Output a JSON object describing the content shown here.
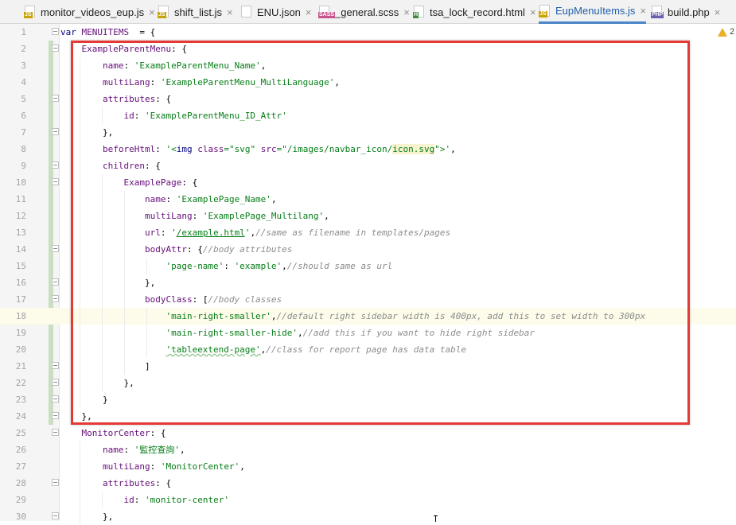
{
  "tabs": [
    {
      "name": "monitor_videos_eup.js",
      "type": "JS",
      "type_color": "#c8a400"
    },
    {
      "name": "shift_list.js",
      "type": "JS",
      "type_color": "#c8a400"
    },
    {
      "name": "ENU.json",
      "type": "",
      "type_color": "#9a9a9a"
    },
    {
      "name": "_general.scss",
      "type": "SASS",
      "type_color": "#c6538c"
    },
    {
      "name": "tsa_lock_record.html",
      "type": "H",
      "type_color": "#3e8e41"
    },
    {
      "name": "EupMenuItems.js",
      "type": "JS",
      "type_color": "#c8a400",
      "active": true
    },
    {
      "name": "build.php",
      "type": "PHP",
      "type_color": "#6b5fb0"
    }
  ],
  "close_glyph": "×",
  "warning_count": "2",
  "code_lines": [
    {
      "n": "1",
      "tokens": [
        [
          "k",
          "var "
        ],
        [
          "p",
          "MENUITEMS"
        ],
        [
          "",
          "  = {"
        ]
      ]
    },
    {
      "n": "2",
      "tokens": [
        [
          "",
          "    "
        ],
        [
          "p",
          "ExampleParentMenu"
        ],
        [
          "",
          ": {"
        ]
      ]
    },
    {
      "n": "3",
      "tokens": [
        [
          "",
          "        "
        ],
        [
          "p",
          "name"
        ],
        [
          "",
          ": "
        ],
        [
          "s",
          "'ExampleParentMenu_Name'"
        ],
        [
          "",
          ","
        ]
      ]
    },
    {
      "n": "4",
      "tokens": [
        [
          "",
          "        "
        ],
        [
          "p",
          "multiLang"
        ],
        [
          "",
          ": "
        ],
        [
          "s",
          "'ExampleParentMenu_MultiLanguage'"
        ],
        [
          "",
          ","
        ]
      ]
    },
    {
      "n": "5",
      "tokens": [
        [
          "",
          "        "
        ],
        [
          "p",
          "attributes"
        ],
        [
          "",
          ": {"
        ]
      ]
    },
    {
      "n": "6",
      "tokens": [
        [
          "",
          "            "
        ],
        [
          "p",
          "id"
        ],
        [
          "",
          ": "
        ],
        [
          "s",
          "'ExampleParentMenu_ID_Attr'"
        ]
      ]
    },
    {
      "n": "7",
      "tokens": [
        [
          "",
          "        },"
        ]
      ]
    },
    {
      "n": "8",
      "tokens": [
        [
          "",
          "        "
        ],
        [
          "p",
          "beforeHtml"
        ],
        [
          "",
          ": "
        ],
        [
          "s",
          "'<"
        ],
        [
          "k",
          "img "
        ],
        [
          "p",
          "class"
        ],
        [
          "s",
          "=\"svg\" "
        ],
        [
          "p",
          "src"
        ],
        [
          "s",
          "=\"/images/navbar_icon/"
        ],
        [
          "sh",
          "icon.svg"
        ],
        [
          "s",
          "\">'"
        ],
        [
          "",
          ","
        ]
      ]
    },
    {
      "n": "9",
      "tokens": [
        [
          "",
          "        "
        ],
        [
          "p",
          "children"
        ],
        [
          "",
          ": {"
        ]
      ]
    },
    {
      "n": "10",
      "tokens": [
        [
          "",
          "            "
        ],
        [
          "p",
          "ExamplePage"
        ],
        [
          "",
          ": {"
        ]
      ]
    },
    {
      "n": "11",
      "tokens": [
        [
          "",
          "                "
        ],
        [
          "p",
          "name"
        ],
        [
          "",
          ": "
        ],
        [
          "s",
          "'ExamplePage_Name'"
        ],
        [
          "",
          ","
        ]
      ]
    },
    {
      "n": "12",
      "tokens": [
        [
          "",
          "                "
        ],
        [
          "p",
          "multiLang"
        ],
        [
          "",
          ": "
        ],
        [
          "s",
          "'ExamplePage_Multilang'"
        ],
        [
          "",
          ","
        ]
      ]
    },
    {
      "n": "13",
      "tokens": [
        [
          "",
          "                "
        ],
        [
          "p",
          "url"
        ],
        [
          "",
          ": "
        ],
        [
          "s",
          "'"
        ],
        [
          "su",
          "/example.html"
        ],
        [
          "s",
          "'"
        ],
        [
          "",
          ","
        ],
        [
          "c",
          "//same as filename in templates/pages"
        ]
      ]
    },
    {
      "n": "14",
      "tokens": [
        [
          "",
          "                "
        ],
        [
          "p",
          "bodyAttr"
        ],
        [
          "",
          ": {"
        ],
        [
          "c",
          "//body attributes"
        ]
      ]
    },
    {
      "n": "15",
      "tokens": [
        [
          "",
          "                    "
        ],
        [
          "s",
          "'page-name'"
        ],
        [
          "",
          ": "
        ],
        [
          "s",
          "'example'"
        ],
        [
          "",
          ","
        ],
        [
          "c",
          "//should same as url"
        ]
      ]
    },
    {
      "n": "16",
      "tokens": [
        [
          "",
          "                },"
        ]
      ]
    },
    {
      "n": "17",
      "tokens": [
        [
          "",
          "                "
        ],
        [
          "p",
          "bodyClass"
        ],
        [
          "",
          ": ["
        ],
        [
          "c",
          "//body classes"
        ]
      ]
    },
    {
      "n": "18",
      "tokens": [
        [
          "",
          "                    "
        ],
        [
          "s",
          "'main-right-smaller'"
        ],
        [
          "",
          ","
        ],
        [
          "c",
          "//default right sidebar width is 400px, add this to set width to 300px"
        ]
      ],
      "current": true
    },
    {
      "n": "19",
      "tokens": [
        [
          "",
          "                    "
        ],
        [
          "s",
          "'main-right-smaller-hide'"
        ],
        [
          "",
          ","
        ],
        [
          "c",
          "//add this if you want to hide right sidebar"
        ]
      ]
    },
    {
      "n": "20",
      "tokens": [
        [
          "",
          "                    "
        ],
        [
          "sw",
          "'tableextend-page'"
        ],
        [
          "",
          ","
        ],
        [
          "c",
          "//class for report page has data table"
        ]
      ]
    },
    {
      "n": "21",
      "tokens": [
        [
          "",
          "                ]"
        ]
      ]
    },
    {
      "n": "22",
      "tokens": [
        [
          "",
          "            },"
        ]
      ]
    },
    {
      "n": "23",
      "tokens": [
        [
          "",
          "        }"
        ]
      ]
    },
    {
      "n": "24",
      "tokens": [
        [
          "",
          "    },"
        ]
      ]
    },
    {
      "n": "25",
      "tokens": [
        [
          "",
          "    "
        ],
        [
          "p",
          "MonitorCenter"
        ],
        [
          "",
          ": {"
        ]
      ]
    },
    {
      "n": "26",
      "tokens": [
        [
          "",
          "        "
        ],
        [
          "p",
          "name"
        ],
        [
          "",
          ": "
        ],
        [
          "s",
          "'監控查詢'"
        ],
        [
          "",
          ","
        ]
      ]
    },
    {
      "n": "27",
      "tokens": [
        [
          "",
          "        "
        ],
        [
          "p",
          "multiLang"
        ],
        [
          "",
          ": "
        ],
        [
          "s",
          "'MonitorCenter'"
        ],
        [
          "",
          ","
        ]
      ]
    },
    {
      "n": "28",
      "tokens": [
        [
          "",
          "        "
        ],
        [
          "p",
          "attributes"
        ],
        [
          "",
          ": {"
        ]
      ]
    },
    {
      "n": "29",
      "tokens": [
        [
          "",
          "            "
        ],
        [
          "p",
          "id"
        ],
        [
          "",
          ": "
        ],
        [
          "s",
          "'monitor-center'"
        ]
      ]
    },
    {
      "n": "30",
      "tokens": [
        [
          "",
          "        },"
        ]
      ]
    }
  ]
}
